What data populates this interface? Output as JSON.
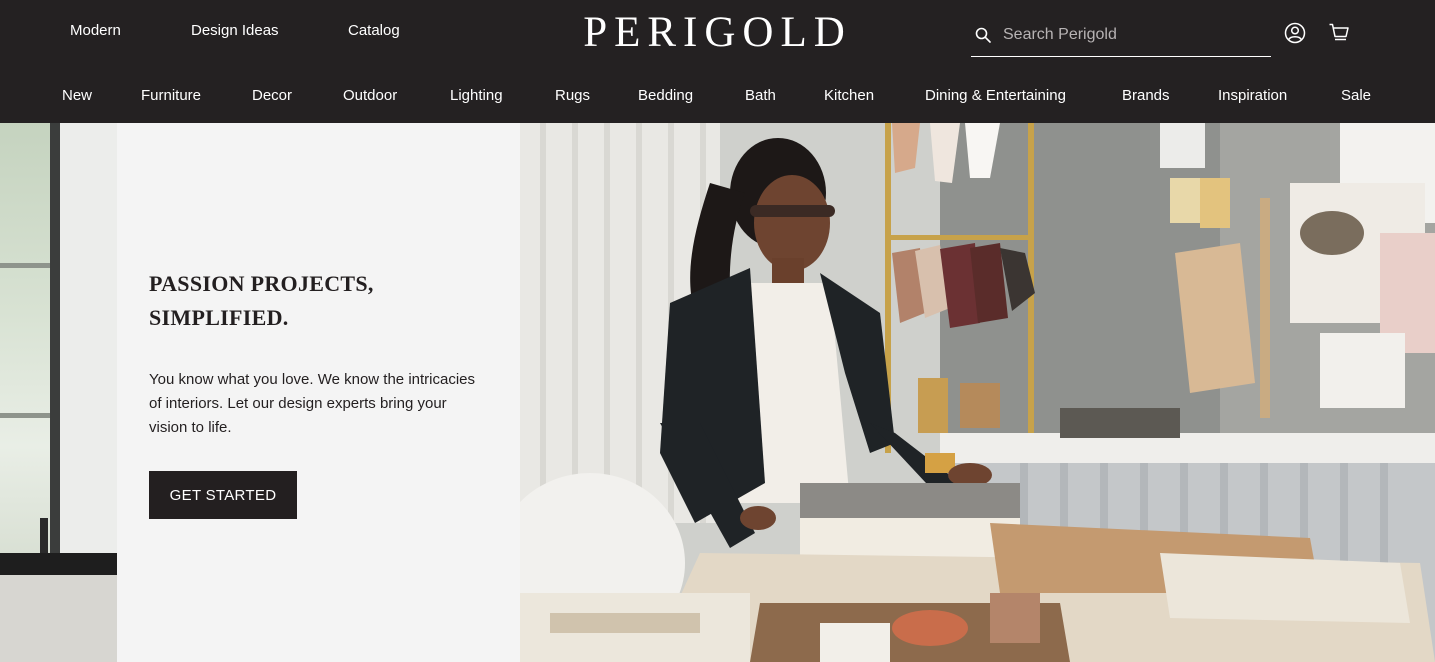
{
  "header": {
    "top_links": [
      "Modern",
      "Design Ideas",
      "Catalog"
    ],
    "logo": "PERIGOLD",
    "search": {
      "placeholder": "Search Perigold",
      "icon": "search-icon"
    },
    "icons": [
      "account-icon",
      "cart-icon"
    ]
  },
  "category_nav": [
    "New",
    "Furniture",
    "Decor",
    "Outdoor",
    "Lighting",
    "Rugs",
    "Bedding",
    "Bath",
    "Kitchen",
    "Dining & Entertaining",
    "Brands",
    "Inspiration",
    "Sale"
  ],
  "hero": {
    "title": "PASSION PROJECTS,\nSIMPLIFIED.",
    "body": "You know what you love. We know the intricacies of interiors. Let our design experts bring your vision to life.",
    "cta_label": "GET STARTED"
  },
  "colors": {
    "header_bg": "#242122",
    "panel_bg": "#f4f4f4",
    "button_bg": "#231f20",
    "text_dark": "#231f20",
    "text_light": "#ffffff"
  }
}
